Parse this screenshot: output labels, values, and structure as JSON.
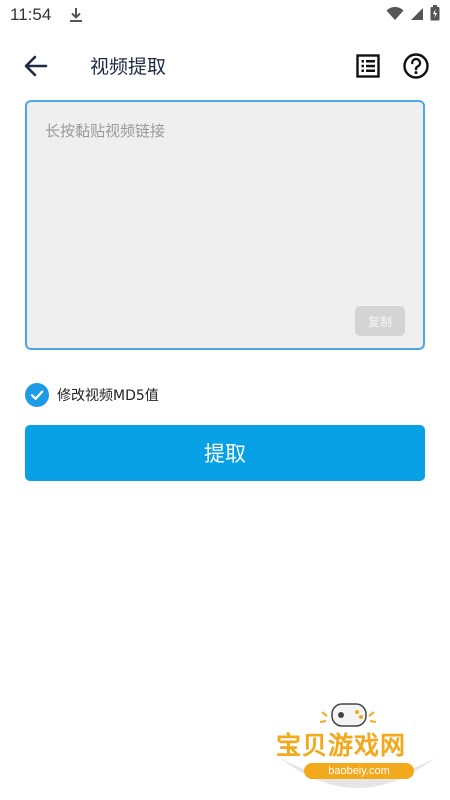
{
  "status_bar": {
    "time": "11:54",
    "icons": [
      "download-icon",
      "wifi-icon",
      "signal-icon",
      "battery-icon"
    ]
  },
  "toolbar": {
    "title": "视频提取",
    "icons": [
      "arrow-left-icon",
      "list-icon",
      "help-icon"
    ]
  },
  "link_input": {
    "placeholder": "长按黏贴视频链接",
    "value": ""
  },
  "copy_button": {
    "label": "复制"
  },
  "md5_option": {
    "label": "修改视频MD5值",
    "checked": true
  },
  "extract_button": {
    "label": "提取"
  },
  "watermark": {
    "title": "宝贝游戏网",
    "url": "baobeiy.com"
  },
  "colors": {
    "accent": "#08a1e6",
    "checkbox": "#1e9be6",
    "input_border": "#4aa8e8",
    "input_bg": "#efefef",
    "title": "#1c2a44",
    "watermark": "#f2a91c"
  }
}
